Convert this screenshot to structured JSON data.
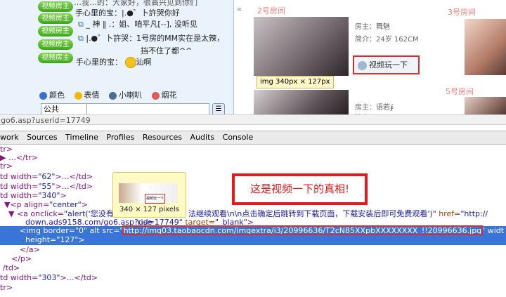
{
  "chat": {
    "badge": "视频房主",
    "lines": [
      {
        "badge": true,
        "text": "…我…的：大家好，很高兴见到你们"
      },
      {
        "badge": true,
        "text": "手心里的宝：|.●゜卜許哭你好"
      },
      {
        "badge": true,
        "text": "_ 神 ‖ .：姐、咱平凡[--],    没听见"
      },
      {
        "badge": true,
        "text": "|.●゜卜許哭：1号房的MM实在是太辣，"
      },
      {
        "badge": true,
        "text": "挡不住了都^^"
      },
      {
        "badge": false,
        "text": "手心里的宝：  ",
        "emoji_label": "汕啊"
      }
    ],
    "toolbar": [
      "颜色",
      "表情",
      "小喇叭",
      "烟花"
    ],
    "channel": "公共"
  },
  "rooms": {
    "room2_title": "2号房间",
    "room3_title": "3号房间",
    "room5_title": "5号房间",
    "room2_host": "房主：舞魅",
    "room2_intro": "简介：24岁 162CM",
    "room4_host": "房主：语若∮",
    "room4_intro": "简介：",
    "watch_button": "视频玩一下",
    "img_tip": "img  340px × 127px"
  },
  "address": "go6.asp?userid=17749",
  "devtools": {
    "tabs": [
      "work",
      "Sources",
      "Timeline",
      "Profiles",
      "Resources",
      "Audits",
      "Console"
    ],
    "preview_caption": "340 × 127 pixels",
    "preview_button": "视频玩一下",
    "annotation": "这是视频一下的真相!",
    "lines": {
      "l1": "tr>",
      "l2": "…</tr>",
      "l3": "tr>",
      "l4a": "td width=",
      "l4b": "\"62\"",
      "l4c": ">…</td>",
      "l5a": "td width=",
      "l5b": "\"55\"",
      "l5c": ">…</td>",
      "l6a": "td width=",
      "l6b": "\"340\"",
      "l6c": ">",
      "l7a": "<p align=",
      "l7b": "\"center\"",
      "l7c": ">",
      "l8a": "<a onclick=",
      "l8b": "\"alert('您没有",
      "l8c": "法继续观看\\n\\n点击确定后跳转到下载页面，下载安装后即可免费观看')\"",
      "l8d": " href=",
      "l8e": "\"http://",
      "l9a": "down.ads9158.com/go6.asp?use",
      "l9b": "rid=17749\"",
      "l9c": " target=",
      "l9d": "\"_blank\"",
      "l9e": ">",
      "l10a": "<img border=\"0\" alt src=\"",
      "l10url": "http://img03.taobaocdn.com/imgextra/i3/20996636/T2cN85XXpbXXXXXXXX_!!20996636.jpg",
      "l10b": "\" widt",
      "l11": "height=\"127\">",
      "l12": "</a>",
      "l13": "</p>",
      "l14": "/td>",
      "l15a": "td width=",
      "l15b": "\"303\"",
      "l15c": ">…</td>",
      "l16": "tr>"
    }
  },
  "colors": {
    "accent_red": "#e02b2b",
    "selection": "#3875d7",
    "badge_green": "#3ea61a"
  }
}
